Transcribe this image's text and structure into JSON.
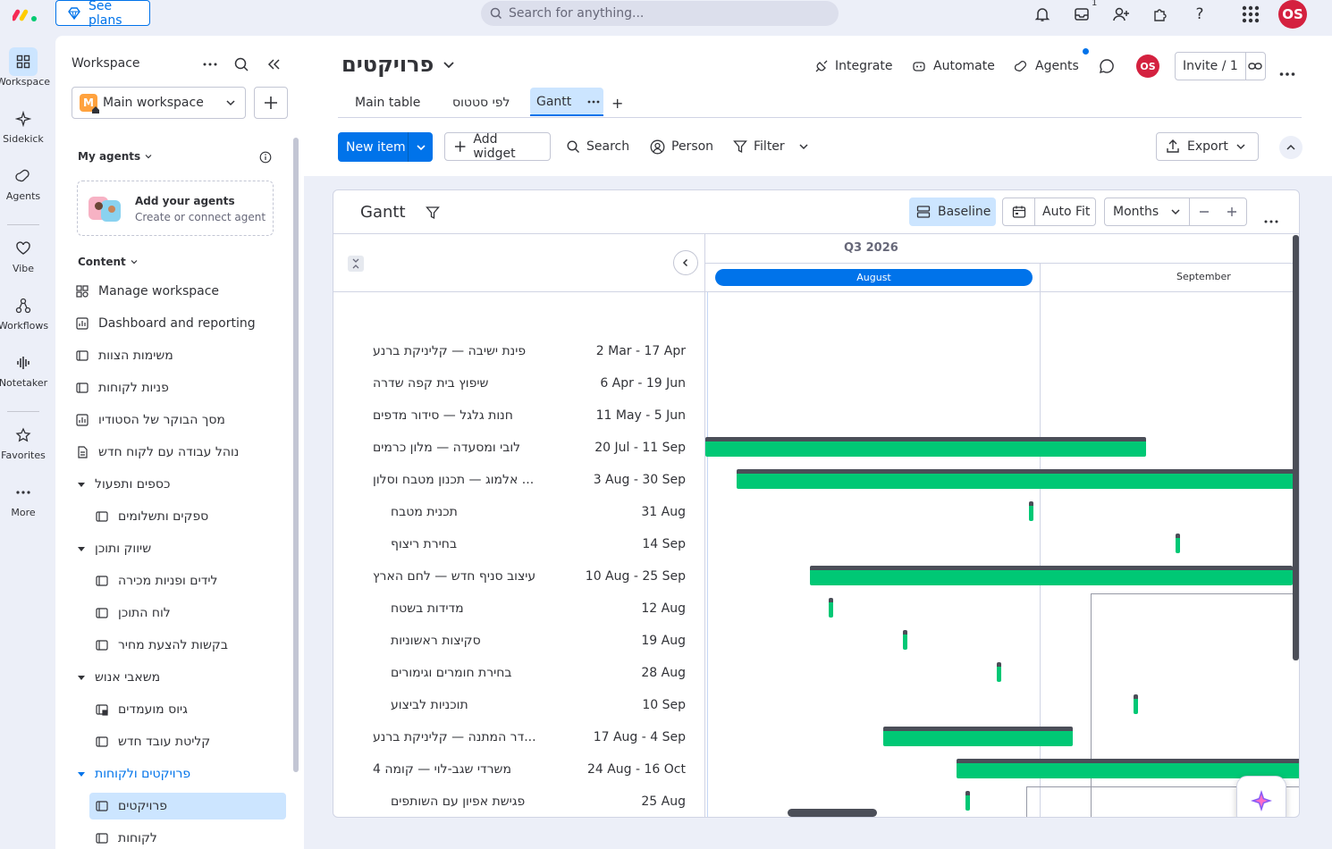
{
  "topbar": {
    "see_plans": "See plans",
    "search_placeholder": "Search for anything...",
    "inbox_count": "1",
    "user_initials": "OS"
  },
  "rail": {
    "items": [
      {
        "label": "Workspace",
        "icon": "grid-icon"
      },
      {
        "label": "Sidekick",
        "icon": "sparkle-icon"
      },
      {
        "label": "Agents",
        "icon": "agents-icon"
      },
      {
        "label": "Vibe",
        "icon": "heart-icon"
      },
      {
        "label": "Workflows",
        "icon": "workflows-icon"
      },
      {
        "label": "Notetaker",
        "icon": "soundwave-icon"
      },
      {
        "label": "Favorites",
        "icon": "star-icon"
      },
      {
        "label": "More",
        "icon": "ellipsis-icon"
      }
    ]
  },
  "sidebar": {
    "title": "Workspace",
    "workspace_initial": "M",
    "workspace_name": "Main workspace",
    "my_agents": "My agents",
    "add_agents_title": "Add your agents",
    "add_agents_sub": "Create or connect agent",
    "content": "Content",
    "items": [
      {
        "label": "Manage workspace",
        "icon": "manage-icon",
        "level": 0
      },
      {
        "label": "Dashboard and reporting",
        "icon": "dashboard-icon",
        "level": 0
      },
      {
        "label": "משימות הצוות",
        "icon": "board-icon",
        "level": 0
      },
      {
        "label": "פניות לקוחות",
        "icon": "board-icon",
        "level": 0
      },
      {
        "label": "מסך הבוקר של הסטודיו",
        "icon": "dashboard-icon",
        "level": 0
      },
      {
        "label": "נוהל עבודה עם לקוח חדש",
        "icon": "doc-icon",
        "level": 0
      },
      {
        "label": "כספים ותפעול",
        "icon": "folder-caret",
        "level": 0
      },
      {
        "label": "ספקים ותשלומים",
        "icon": "board-icon",
        "level": 1
      },
      {
        "label": "שיווק ותוכן",
        "icon": "folder-caret",
        "level": 0
      },
      {
        "label": "לידים ופניות מכירה",
        "icon": "board-icon",
        "level": 1
      },
      {
        "label": "לוח התוכן",
        "icon": "board-icon",
        "level": 1
      },
      {
        "label": "בקשות להצעת מחיר",
        "icon": "board-icon",
        "level": 1
      },
      {
        "label": "משאבי אנוש",
        "icon": "folder-caret",
        "level": 0
      },
      {
        "label": "גיוס מועמדים",
        "icon": "locked-board-icon",
        "level": 1
      },
      {
        "label": "קליטת עובד חדש",
        "icon": "board-icon",
        "level": 1
      },
      {
        "label": "פרויקטים ולקוחות",
        "icon": "folder-caret",
        "level": 0
      },
      {
        "label": "פרויקטים",
        "icon": "board-icon",
        "level": 1
      },
      {
        "label": "לקוחות",
        "icon": "board-icon",
        "level": 1
      }
    ]
  },
  "board": {
    "title": "פרויקטים",
    "integrate": "Integrate",
    "automate": "Automate",
    "agents": "Agents",
    "member_initials": "OS",
    "invite": "Invite / 1",
    "tabs": [
      "Main table",
      "לפי סטטוס",
      "Gantt"
    ],
    "add_tab": "+",
    "new_item": "New item",
    "add_widget": "Add widget",
    "search": "Search",
    "person": "Person",
    "filter": "Filter",
    "export": "Export"
  },
  "gantt": {
    "title": "Gantt",
    "baseline": "Baseline",
    "auto_fit": "Auto Fit",
    "zoom": "Months",
    "quarter": "Q3 2026",
    "months": [
      "August",
      "September"
    ],
    "rows": [
      {
        "name": "פינת ישיבה — קליניקת ברנע",
        "dates": "2 Mar - 17 Apr",
        "sub": false
      },
      {
        "name": "שיפוץ בית קפה שדרה",
        "dates": "6 Apr - 19 Jun",
        "sub": false
      },
      {
        "name": "חנות גלגל — סידור מדפים",
        "dates": "11 May - 5 Jun",
        "sub": false
      },
      {
        "name": "לובי ומסעדה — מלון כרמים",
        "dates": "20 Jul - 11 Sep",
        "sub": false
      },
      {
        "name": "... אלמוג — תכנון מטבח וסלון",
        "dates": "3 Aug - 30 Sep",
        "sub": false
      },
      {
        "name": "תכנית מטבח",
        "dates": "31 Aug",
        "sub": true
      },
      {
        "name": "בחירת ריצוף",
        "dates": "14 Sep",
        "sub": true
      },
      {
        "name": "עיצוב סניף חדש — לחם הארץ",
        "dates": "10 Aug - 25 Sep",
        "sub": false
      },
      {
        "name": "מדידות בשטח",
        "dates": "12 Aug",
        "sub": true
      },
      {
        "name": "סקיצות ראשוניות",
        "dates": "19 Aug",
        "sub": true
      },
      {
        "name": "בחירת חומרים וגימורים",
        "dates": "28 Aug",
        "sub": true
      },
      {
        "name": "תוכניות לביצוע",
        "dates": "10 Sep",
        "sub": true
      },
      {
        "name": "...דר המתנה — קליניקת ברנע",
        "dates": "17 Aug - 4 Sep",
        "sub": false
      },
      {
        "name": "משרדי שגב-לוי — קומה 4",
        "dates": "24 Aug - 16 Oct",
        "sub": false
      },
      {
        "name": "פגישת אפיון עם השותפים",
        "dates": "25 Aug",
        "sub": true
      }
    ]
  }
}
